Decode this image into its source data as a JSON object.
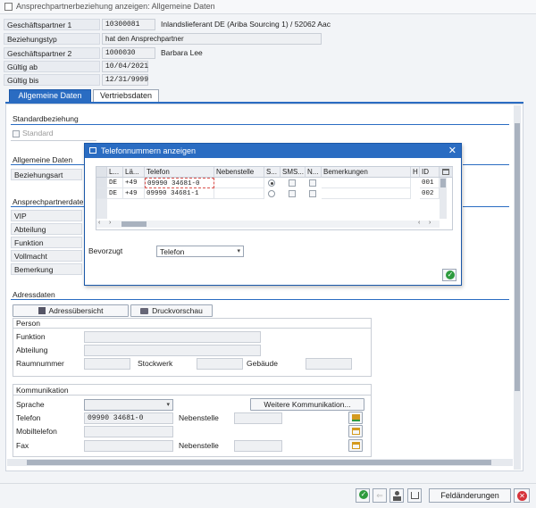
{
  "window": {
    "title": "Ansprechpartnerbeziehung anzeigen: Allgemeine Daten"
  },
  "header": {
    "gp1_label": "Geschäftspartner 1",
    "gp1_value": "10300081",
    "gp1_desc": "Inlandslieferant DE (Ariba Sourcing 1) / 52062 Aac",
    "bez_label": "Beziehungstyp",
    "bez_value": "hat den Ansprechpartner",
    "gp2_label": "Geschäftspartner 2",
    "gp2_value": "1000030",
    "gp2_desc": "Barbara Lee",
    "ab_label": "Gültig ab",
    "ab_value": "10/04/2021",
    "bis_label": "Gültig bis",
    "bis_value": "12/31/9999"
  },
  "tabs": [
    {
      "label": "Allgemeine Daten"
    },
    {
      "label": "Vertriebsdaten"
    }
  ],
  "standard": {
    "title": "Standardbeziehung",
    "checkbox_label": "Standard"
  },
  "allgemein": {
    "title": "Allgemeine Daten",
    "beziehungsart_label": "Beziehungsart"
  },
  "ansprech": {
    "title": "Ansprechpartnerdate",
    "vip": "VIP",
    "abteilung": "Abteilung",
    "funktion": "Funktion",
    "vollmacht": "Vollmacht",
    "bemerkung": "Bemerkung"
  },
  "adress": {
    "title": "Adressdaten",
    "uebersicht_btn": "Adressübersicht",
    "druck_btn": "Druckvorschau",
    "person_title": "Person",
    "funktion": "Funktion",
    "abteilung": "Abteilung",
    "raumnummer": "Raumnummer",
    "stockwerk": "Stockwerk",
    "gebaeude": "Gebäude"
  },
  "komm": {
    "title": "Kommunikation",
    "sprache": "Sprache",
    "weitere_btn": "Weitere Kommunikation...",
    "telefon": "Telefon",
    "telefon_value": "09990 34681-0",
    "nebenstelle": "Nebenstelle",
    "mobil": "Mobiltelefon",
    "fax": "Fax",
    "nebenstelle2": "Nebenstelle"
  },
  "dialog": {
    "title": "Telefonnummern anzeigen",
    "columns": [
      "L...",
      "Lä...",
      "Telefon",
      "Nebenstelle",
      "S...",
      "SMS...",
      "N...",
      "Bemerkungen",
      "H",
      "ID"
    ],
    "rows": [
      {
        "land": "DE",
        "vorwahl": "+49",
        "telefon": "09990 34681-0",
        "id": "001"
      },
      {
        "land": "DE",
        "vorwahl": "+49",
        "telefon": "09990 34681-1",
        "id": "002"
      }
    ],
    "bevorzugt_label": "Bevorzugt",
    "bevorzugt_value": "Telefon"
  },
  "footer": {
    "feldaenderungen": "Feldänderungen"
  },
  "colors": {
    "accent": "#2a6cc2",
    "ok": "#2e9b3e",
    "cancel": "#d6333a"
  }
}
